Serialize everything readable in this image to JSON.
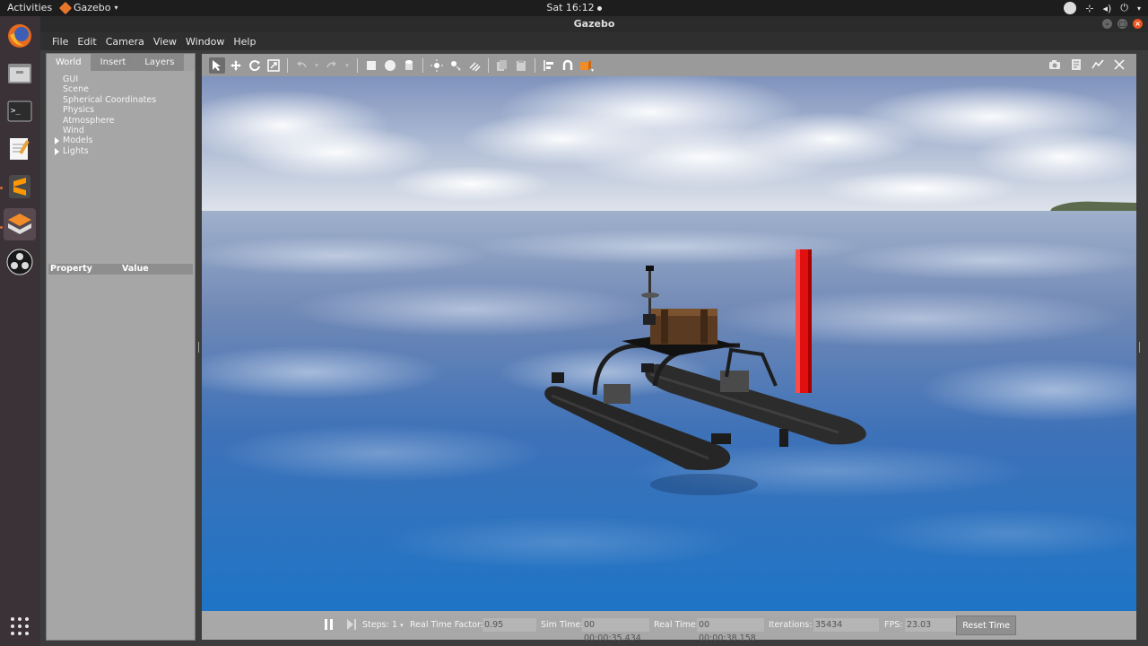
{
  "topbar": {
    "activities": "Activities",
    "app_name": "Gazebo",
    "clock": "Sat 16:12"
  },
  "window": {
    "title": "Gazebo"
  },
  "menu": [
    "File",
    "Edit",
    "Camera",
    "View",
    "Window",
    "Help"
  ],
  "left_panel": {
    "tabs": [
      "World",
      "Insert",
      "Layers"
    ],
    "selected_tab": "World",
    "tree": [
      {
        "label": "GUI",
        "expandable": false
      },
      {
        "label": "Scene",
        "expandable": false
      },
      {
        "label": "Spherical Coordinates",
        "expandable": false
      },
      {
        "label": "Physics",
        "expandable": false
      },
      {
        "label": "Atmosphere",
        "expandable": false
      },
      {
        "label": "Wind",
        "expandable": false
      },
      {
        "label": "Models",
        "expandable": true
      },
      {
        "label": "Lights",
        "expandable": true
      }
    ],
    "property_header": "Property",
    "value_header": "Value"
  },
  "toolbar": {
    "tools": [
      "select-arrow-icon",
      "translate-icon",
      "rotate-icon",
      "scale-icon",
      "undo-icon",
      "redo-icon",
      "box-icon",
      "sphere-icon",
      "cylinder-icon",
      "point-light-icon",
      "spot-light-icon",
      "directional-light-icon",
      "copy-icon",
      "paste-icon",
      "align-icon",
      "snap-icon",
      "view-angle-icon"
    ],
    "right_tools": [
      "screenshot-icon",
      "log-icon",
      "plot-icon",
      "video-icon"
    ]
  },
  "bottom": {
    "steps_label": "Steps:",
    "steps_value": "1",
    "rtf_label": "Real Time Factor:",
    "rtf_value": "0.95",
    "sim_label": "Sim Time:",
    "sim_value": "00 00:00:35.434",
    "real_label": "Real Time:",
    "real_value": "00 00:00:38.158",
    "iter_label": "Iterations:",
    "iter_value": "35434",
    "fps_label": "FPS:",
    "fps_value": "23.03",
    "reset_label": "Reset Time"
  },
  "colors": {
    "sky_top": "#7f93bd",
    "sky_horizon": "#d9e0ea",
    "water_far": "#8298bd",
    "water_near": "#1f74c4",
    "pole": "#e01010",
    "boat": "#2a2a2a",
    "accent": "#e95420"
  }
}
